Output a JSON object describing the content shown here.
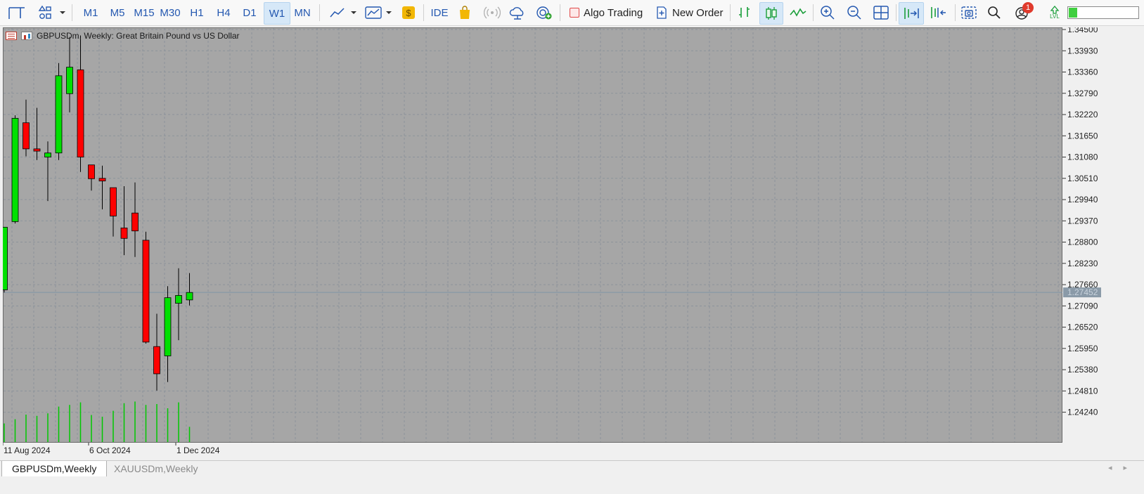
{
  "toolbar": {
    "timeframes": [
      "M1",
      "M5",
      "M15",
      "M30",
      "H1",
      "H4",
      "D1",
      "W1",
      "MN"
    ],
    "active_timeframe": "W1",
    "ide_label": "IDE",
    "algo_trading_label": "Algo Trading",
    "new_order_label": "New Order",
    "notification_count": "1",
    "level_label": "LVL"
  },
  "chart": {
    "title": "GBPUSDm, Weekly:  Great Britain Pound vs US Dollar",
    "current_price": "1.27452",
    "colors": {
      "background": "#a6a6a6",
      "bull": "#00e000",
      "bear": "#ff0000",
      "wick": "#000000",
      "volume": "#00c800",
      "price_line": "#7f95a6"
    }
  },
  "chart_data": {
    "type": "candlestick",
    "symbol": "GBPUSDm",
    "timeframe": "Weekly",
    "y_axis_ticks": [
      "1.34500",
      "1.33930",
      "1.33360",
      "1.32790",
      "1.32220",
      "1.31650",
      "1.31080",
      "1.30510",
      "1.29940",
      "1.29370",
      "1.28800",
      "1.28230",
      "1.27660",
      "1.27090",
      "1.26520",
      "1.25950",
      "1.25380",
      "1.24810",
      "1.24240"
    ],
    "ylim": [
      1.2395,
      1.345
    ],
    "x_axis_labels": [
      "11 Aug 2024",
      "6 Oct 2024",
      "1 Dec 2024"
    ],
    "candles": [
      {
        "o": 1.2752,
        "h": 1.292,
        "l": 1.2745,
        "c": 1.292
      },
      {
        "o": 1.2935,
        "h": 1.322,
        "l": 1.293,
        "c": 1.3212
      },
      {
        "o": 1.32,
        "h": 1.3262,
        "l": 1.311,
        "c": 1.313
      },
      {
        "o": 1.313,
        "h": 1.324,
        "l": 1.31,
        "c": 1.3124
      },
      {
        "o": 1.3108,
        "h": 1.315,
        "l": 1.299,
        "c": 1.3119
      },
      {
        "o": 1.3119,
        "h": 1.336,
        "l": 1.31,
        "c": 1.3326
      },
      {
        "o": 1.3278,
        "h": 1.343,
        "l": 1.3228,
        "c": 1.3349
      },
      {
        "o": 1.3342,
        "h": 1.3434,
        "l": 1.3068,
        "c": 1.3108
      },
      {
        "o": 1.3087,
        "h": 1.3087,
        "l": 1.3018,
        "c": 1.305
      },
      {
        "o": 1.3051,
        "h": 1.3085,
        "l": 1.2968,
        "c": 1.3044
      },
      {
        "o": 1.3026,
        "h": 1.3026,
        "l": 1.2895,
        "c": 1.295
      },
      {
        "o": 1.2918,
        "h": 1.303,
        "l": 1.2845,
        "c": 1.289
      },
      {
        "o": 1.2958,
        "h": 1.304,
        "l": 1.284,
        "c": 1.291
      },
      {
        "o": 1.2885,
        "h": 1.2908,
        "l": 1.2608,
        "c": 1.2612
      },
      {
        "o": 1.26,
        "h": 1.2688,
        "l": 1.2482,
        "c": 1.2527
      },
      {
        "o": 1.2575,
        "h": 1.2762,
        "l": 1.2505,
        "c": 1.2731
      },
      {
        "o": 1.2716,
        "h": 1.281,
        "l": 1.2617,
        "c": 1.2737
      },
      {
        "o": 1.2725,
        "h": 1.2797,
        "l": 1.271,
        "c": 1.2745
      }
    ],
    "volume_relative": [
      0.44,
      0.54,
      0.65,
      0.62,
      0.68,
      0.84,
      0.88,
      0.94,
      0.64,
      0.6,
      0.74,
      0.92,
      0.96,
      0.88,
      0.9,
      0.8,
      0.94,
      0.36
    ]
  },
  "tabs": [
    {
      "label": "GBPUSDm,Weekly",
      "active": true
    },
    {
      "label": "XAUUSDm,Weekly",
      "active": false
    }
  ]
}
